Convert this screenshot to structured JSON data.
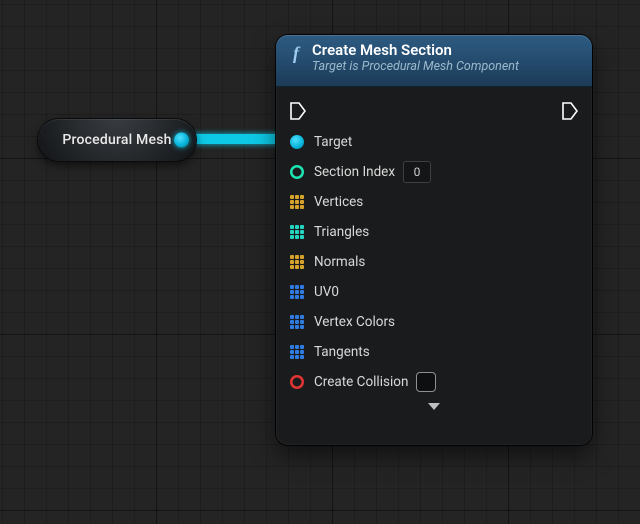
{
  "pill": {
    "label": "Procedural Mesh"
  },
  "node": {
    "title": "Create Mesh Section",
    "subtitle": "Target is Procedural Mesh Component",
    "pins": {
      "target": "Target",
      "section_index": "Section Index",
      "section_index_value": "0",
      "vertices": "Vertices",
      "triangles": "Triangles",
      "normals": "Normals",
      "uv0": "UV0",
      "vertex_colors": "Vertex Colors",
      "tangents": "Tangents",
      "create_collision": "Create Collision"
    }
  }
}
